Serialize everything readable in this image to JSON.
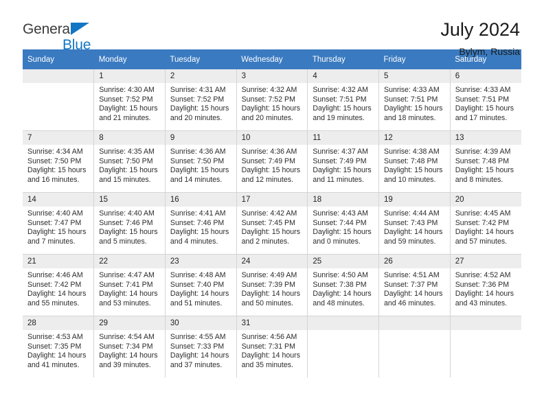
{
  "brand": {
    "line1": "General",
    "line2": "Blue",
    "triangle_color": "#1276c4"
  },
  "header": {
    "title": "July 2024",
    "subtitle": "Bylym, Russia"
  },
  "theme": {
    "header_row_bg": "#3a7ac0",
    "daynum_bg": "#ededed",
    "grid_line": "#d4d4d4",
    "accent": "#1276c4"
  },
  "weekdays": [
    "Sunday",
    "Monday",
    "Tuesday",
    "Wednesday",
    "Thursday",
    "Friday",
    "Saturday"
  ],
  "weeks": [
    [
      {
        "day": "",
        "empty": true,
        "sunrise": "",
        "sunset": "",
        "daylight1": "",
        "daylight2": ""
      },
      {
        "day": "1",
        "empty": false,
        "sunrise": "Sunrise: 4:30 AM",
        "sunset": "Sunset: 7:52 PM",
        "daylight1": "Daylight: 15 hours",
        "daylight2": "and 21 minutes."
      },
      {
        "day": "2",
        "empty": false,
        "sunrise": "Sunrise: 4:31 AM",
        "sunset": "Sunset: 7:52 PM",
        "daylight1": "Daylight: 15 hours",
        "daylight2": "and 20 minutes."
      },
      {
        "day": "3",
        "empty": false,
        "sunrise": "Sunrise: 4:32 AM",
        "sunset": "Sunset: 7:52 PM",
        "daylight1": "Daylight: 15 hours",
        "daylight2": "and 20 minutes."
      },
      {
        "day": "4",
        "empty": false,
        "sunrise": "Sunrise: 4:32 AM",
        "sunset": "Sunset: 7:51 PM",
        "daylight1": "Daylight: 15 hours",
        "daylight2": "and 19 minutes."
      },
      {
        "day": "5",
        "empty": false,
        "sunrise": "Sunrise: 4:33 AM",
        "sunset": "Sunset: 7:51 PM",
        "daylight1": "Daylight: 15 hours",
        "daylight2": "and 18 minutes."
      },
      {
        "day": "6",
        "empty": false,
        "sunrise": "Sunrise: 4:33 AM",
        "sunset": "Sunset: 7:51 PM",
        "daylight1": "Daylight: 15 hours",
        "daylight2": "and 17 minutes."
      }
    ],
    [
      {
        "day": "7",
        "empty": false,
        "sunrise": "Sunrise: 4:34 AM",
        "sunset": "Sunset: 7:50 PM",
        "daylight1": "Daylight: 15 hours",
        "daylight2": "and 16 minutes."
      },
      {
        "day": "8",
        "empty": false,
        "sunrise": "Sunrise: 4:35 AM",
        "sunset": "Sunset: 7:50 PM",
        "daylight1": "Daylight: 15 hours",
        "daylight2": "and 15 minutes."
      },
      {
        "day": "9",
        "empty": false,
        "sunrise": "Sunrise: 4:36 AM",
        "sunset": "Sunset: 7:50 PM",
        "daylight1": "Daylight: 15 hours",
        "daylight2": "and 14 minutes."
      },
      {
        "day": "10",
        "empty": false,
        "sunrise": "Sunrise: 4:36 AM",
        "sunset": "Sunset: 7:49 PM",
        "daylight1": "Daylight: 15 hours",
        "daylight2": "and 12 minutes."
      },
      {
        "day": "11",
        "empty": false,
        "sunrise": "Sunrise: 4:37 AM",
        "sunset": "Sunset: 7:49 PM",
        "daylight1": "Daylight: 15 hours",
        "daylight2": "and 11 minutes."
      },
      {
        "day": "12",
        "empty": false,
        "sunrise": "Sunrise: 4:38 AM",
        "sunset": "Sunset: 7:48 PM",
        "daylight1": "Daylight: 15 hours",
        "daylight2": "and 10 minutes."
      },
      {
        "day": "13",
        "empty": false,
        "sunrise": "Sunrise: 4:39 AM",
        "sunset": "Sunset: 7:48 PM",
        "daylight1": "Daylight: 15 hours",
        "daylight2": "and 8 minutes."
      }
    ],
    [
      {
        "day": "14",
        "empty": false,
        "sunrise": "Sunrise: 4:40 AM",
        "sunset": "Sunset: 7:47 PM",
        "daylight1": "Daylight: 15 hours",
        "daylight2": "and 7 minutes."
      },
      {
        "day": "15",
        "empty": false,
        "sunrise": "Sunrise: 4:40 AM",
        "sunset": "Sunset: 7:46 PM",
        "daylight1": "Daylight: 15 hours",
        "daylight2": "and 5 minutes."
      },
      {
        "day": "16",
        "empty": false,
        "sunrise": "Sunrise: 4:41 AM",
        "sunset": "Sunset: 7:46 PM",
        "daylight1": "Daylight: 15 hours",
        "daylight2": "and 4 minutes."
      },
      {
        "day": "17",
        "empty": false,
        "sunrise": "Sunrise: 4:42 AM",
        "sunset": "Sunset: 7:45 PM",
        "daylight1": "Daylight: 15 hours",
        "daylight2": "and 2 minutes."
      },
      {
        "day": "18",
        "empty": false,
        "sunrise": "Sunrise: 4:43 AM",
        "sunset": "Sunset: 7:44 PM",
        "daylight1": "Daylight: 15 hours",
        "daylight2": "and 0 minutes."
      },
      {
        "day": "19",
        "empty": false,
        "sunrise": "Sunrise: 4:44 AM",
        "sunset": "Sunset: 7:43 PM",
        "daylight1": "Daylight: 14 hours",
        "daylight2": "and 59 minutes."
      },
      {
        "day": "20",
        "empty": false,
        "sunrise": "Sunrise: 4:45 AM",
        "sunset": "Sunset: 7:42 PM",
        "daylight1": "Daylight: 14 hours",
        "daylight2": "and 57 minutes."
      }
    ],
    [
      {
        "day": "21",
        "empty": false,
        "sunrise": "Sunrise: 4:46 AM",
        "sunset": "Sunset: 7:42 PM",
        "daylight1": "Daylight: 14 hours",
        "daylight2": "and 55 minutes."
      },
      {
        "day": "22",
        "empty": false,
        "sunrise": "Sunrise: 4:47 AM",
        "sunset": "Sunset: 7:41 PM",
        "daylight1": "Daylight: 14 hours",
        "daylight2": "and 53 minutes."
      },
      {
        "day": "23",
        "empty": false,
        "sunrise": "Sunrise: 4:48 AM",
        "sunset": "Sunset: 7:40 PM",
        "daylight1": "Daylight: 14 hours",
        "daylight2": "and 51 minutes."
      },
      {
        "day": "24",
        "empty": false,
        "sunrise": "Sunrise: 4:49 AM",
        "sunset": "Sunset: 7:39 PM",
        "daylight1": "Daylight: 14 hours",
        "daylight2": "and 50 minutes."
      },
      {
        "day": "25",
        "empty": false,
        "sunrise": "Sunrise: 4:50 AM",
        "sunset": "Sunset: 7:38 PM",
        "daylight1": "Daylight: 14 hours",
        "daylight2": "and 48 minutes."
      },
      {
        "day": "26",
        "empty": false,
        "sunrise": "Sunrise: 4:51 AM",
        "sunset": "Sunset: 7:37 PM",
        "daylight1": "Daylight: 14 hours",
        "daylight2": "and 46 minutes."
      },
      {
        "day": "27",
        "empty": false,
        "sunrise": "Sunrise: 4:52 AM",
        "sunset": "Sunset: 7:36 PM",
        "daylight1": "Daylight: 14 hours",
        "daylight2": "and 43 minutes."
      }
    ],
    [
      {
        "day": "28",
        "empty": false,
        "sunrise": "Sunrise: 4:53 AM",
        "sunset": "Sunset: 7:35 PM",
        "daylight1": "Daylight: 14 hours",
        "daylight2": "and 41 minutes."
      },
      {
        "day": "29",
        "empty": false,
        "sunrise": "Sunrise: 4:54 AM",
        "sunset": "Sunset: 7:34 PM",
        "daylight1": "Daylight: 14 hours",
        "daylight2": "and 39 minutes."
      },
      {
        "day": "30",
        "empty": false,
        "sunrise": "Sunrise: 4:55 AM",
        "sunset": "Sunset: 7:33 PM",
        "daylight1": "Daylight: 14 hours",
        "daylight2": "and 37 minutes."
      },
      {
        "day": "31",
        "empty": false,
        "sunrise": "Sunrise: 4:56 AM",
        "sunset": "Sunset: 7:31 PM",
        "daylight1": "Daylight: 14 hours",
        "daylight2": "and 35 minutes."
      },
      {
        "day": "",
        "empty": true,
        "sunrise": "",
        "sunset": "",
        "daylight1": "",
        "daylight2": ""
      },
      {
        "day": "",
        "empty": true,
        "sunrise": "",
        "sunset": "",
        "daylight1": "",
        "daylight2": ""
      },
      {
        "day": "",
        "empty": true,
        "sunrise": "",
        "sunset": "",
        "daylight1": "",
        "daylight2": ""
      }
    ]
  ]
}
